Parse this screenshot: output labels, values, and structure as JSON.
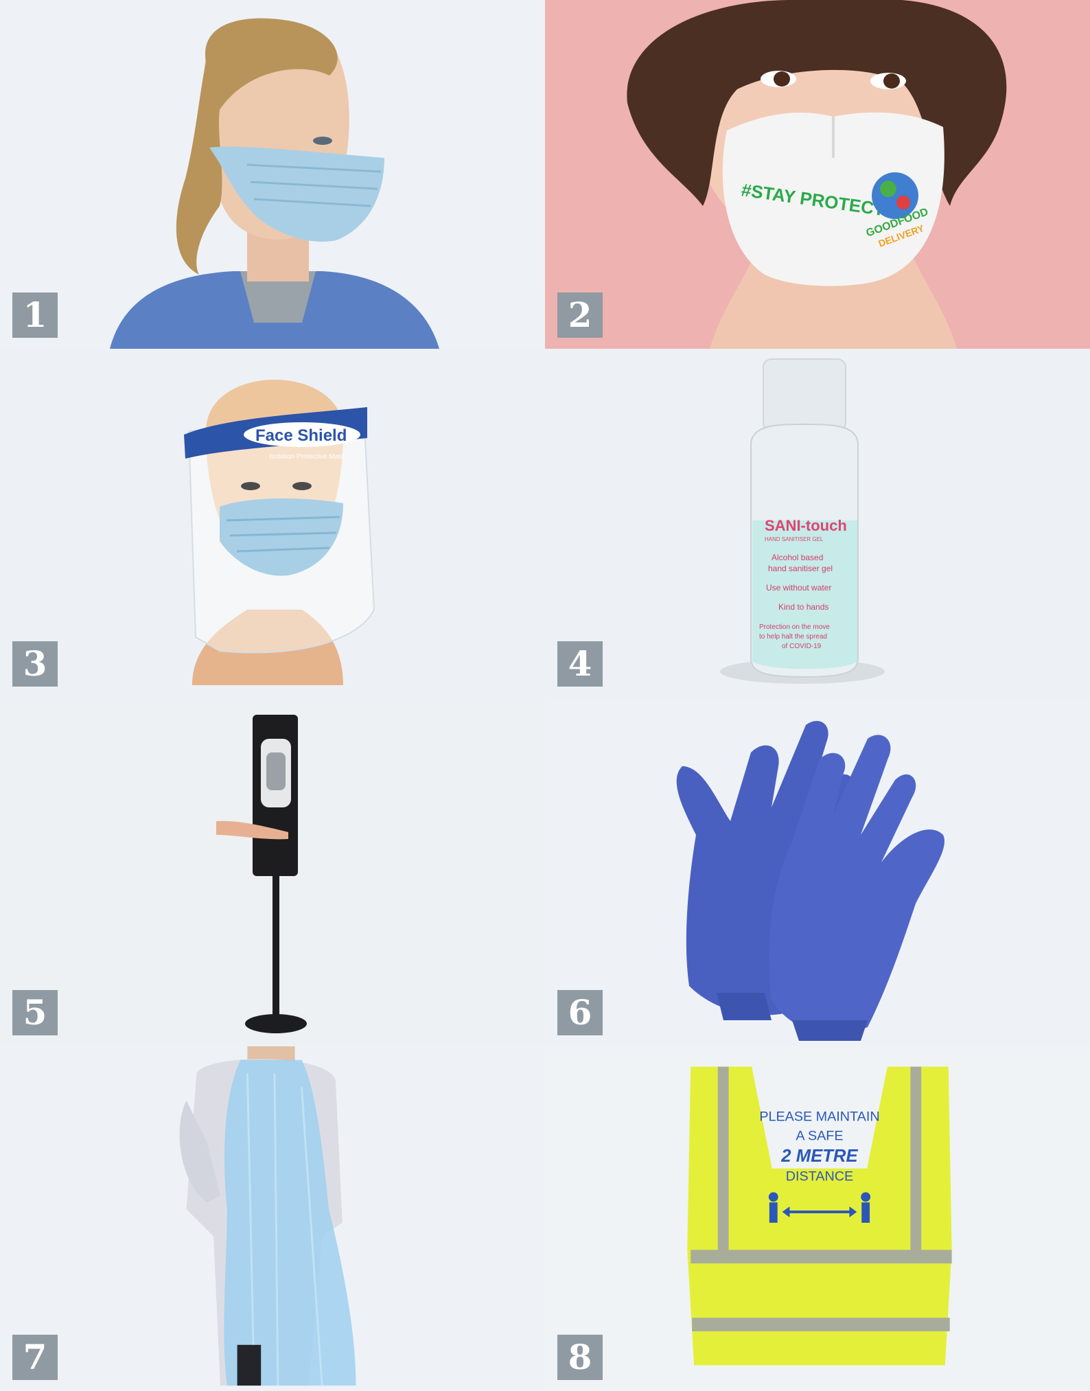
{
  "tiles": [
    {
      "number": "1"
    },
    {
      "number": "2",
      "mask_text": "#STAY PROTECTED",
      "mask_logo_text": "GOODFOOD",
      "mask_logo_sub": "DELIVERY"
    },
    {
      "number": "3",
      "shield_title": "Face Shield",
      "shield_sub": "Isolation Protective Mask"
    },
    {
      "number": "4",
      "brand": "SANI-touch",
      "brand_sub": "HAND SANITISER GEL",
      "lines": [
        "Alcohol based",
        "hand sanitiser gel",
        "Use without water",
        "Kind to hands",
        "Protection on the move",
        "to help halt the spread",
        "of COVID-19"
      ]
    },
    {
      "number": "5"
    },
    {
      "number": "6"
    },
    {
      "number": "7"
    },
    {
      "number": "8",
      "vest_lines": [
        "PLEASE MAINTAIN",
        "A SAFE",
        "2 METRE",
        "DISTANCE"
      ]
    }
  ],
  "colors": {
    "badge": "#8f9aa2",
    "mask_blue": "#a9cfe6",
    "pink_bg": "#eeb2b0",
    "glove_blue": "#4a60c0",
    "vest_yellow": "#e4ef3a",
    "apron_blue": "#9fd0ef"
  }
}
